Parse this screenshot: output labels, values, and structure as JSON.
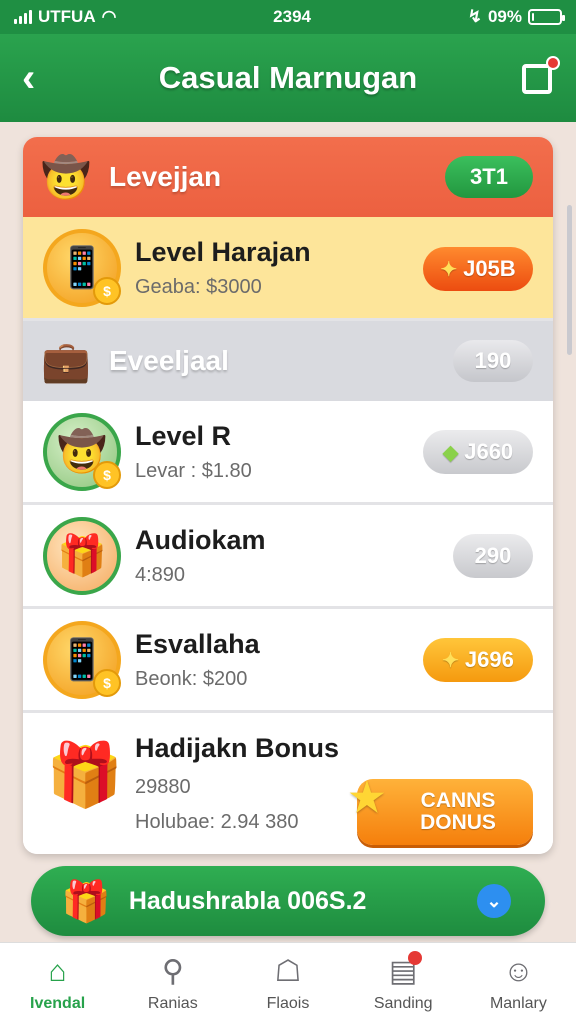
{
  "status_bar": {
    "carrier": "UTFUA",
    "time": "2394",
    "battery": "09%",
    "battery_level": 0.09
  },
  "header": {
    "title": "Casual Marnugan"
  },
  "sections": [
    {
      "title": "Levejjan",
      "pill": "3T1"
    },
    {
      "title": "Eveeljaal",
      "pill": "190"
    }
  ],
  "rows": [
    {
      "name": "Level Harajan",
      "sub": "Geaba: $3000",
      "button": "J05B",
      "icon": "tablet-icon"
    },
    {
      "name": "Level R",
      "sub": "Levar : $1.80",
      "button": "J660",
      "icon": "cowboy-icon"
    },
    {
      "name": "Audiokam",
      "sub": "4:890",
      "button": "290",
      "icon": "gift-icon"
    },
    {
      "name": "Esvallaha",
      "sub": "Beonk: $200",
      "button": "J696",
      "icon": "tablet-icon"
    }
  ],
  "bonus": {
    "name": "Hadijakn Bonus",
    "sub": "29880",
    "line_prefix": "Holubae: ",
    "line_value": "2.94 380",
    "cta": "CANNS DONUS"
  },
  "banner": {
    "text": "Hadushrabla 006S.2"
  },
  "tabs": [
    {
      "label": "Ivendal",
      "icon": "home-icon"
    },
    {
      "label": "Ranias",
      "icon": "search-icon"
    },
    {
      "label": "Flaois",
      "icon": "house-icon"
    },
    {
      "label": "Sanding",
      "icon": "store-icon"
    },
    {
      "label": "Manlary",
      "icon": "profile-icon"
    }
  ],
  "colors": {
    "brand_green": "#1f8f43",
    "section_orange": "#ef6645",
    "highlight_yellow": "#fde59a",
    "accent_orange": "#f57f0c"
  }
}
